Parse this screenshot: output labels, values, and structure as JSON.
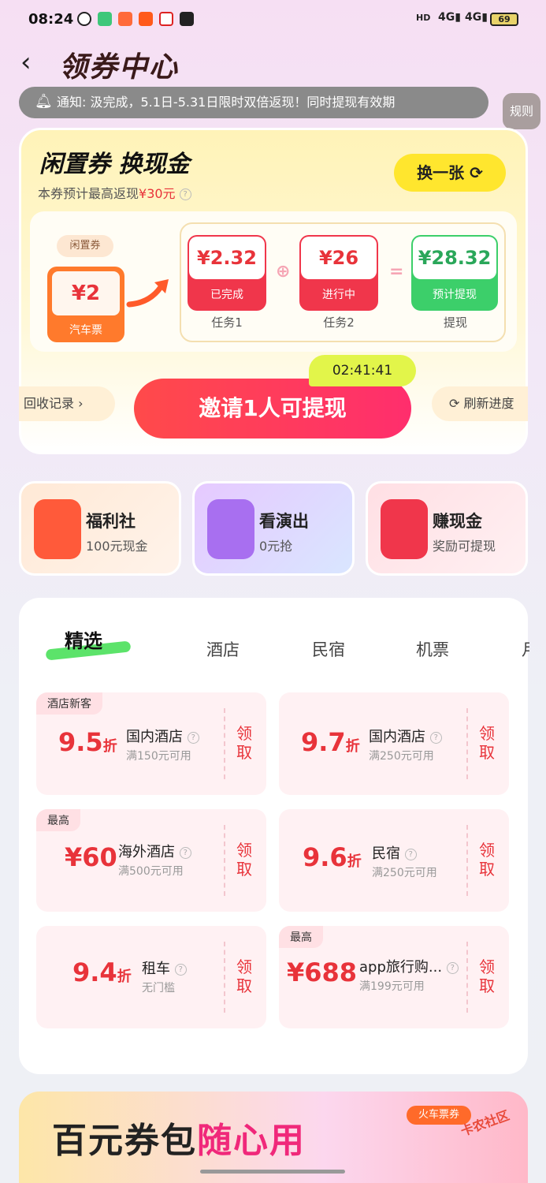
{
  "status": {
    "time": "08:24",
    "battery": "69"
  },
  "header": {
    "title": "领券中心",
    "back_label": "<",
    "rules_label": "规则"
  },
  "notice": {
    "text": "通知: 汲完成，5.1日-5.31日限时双倍返现！同时提现有效期"
  },
  "main_card": {
    "title": "闲置券 换现金",
    "subtitle_prefix": "本券预计最高返现",
    "subtitle_amount": "¥30元",
    "swap_label": "换一张",
    "ticket_tag": "闲置券",
    "ticket_value": "¥2",
    "ticket_label": "汽车票",
    "tasks": [
      {
        "value": "¥2.32",
        "status": "已完成",
        "label": "任务1"
      },
      {
        "value": "¥26",
        "status": "进行中",
        "label": "任务2"
      },
      {
        "value": "¥28.32",
        "status": "预计提现",
        "label": "提现"
      }
    ],
    "invite_label": "邀请1人可提现",
    "countdown": "02:41:41",
    "records_label": "回收记录",
    "refresh_label": "刷新进度"
  },
  "features": [
    {
      "title": "福利社",
      "sub": "100元现金"
    },
    {
      "title": "看演出",
      "sub": "0元抢"
    },
    {
      "title": "赚现金",
      "sub": "奖励可提现"
    }
  ],
  "tabs": [
    "精选",
    "酒店",
    "民宿",
    "机票",
    "月"
  ],
  "coupons": [
    {
      "badge": "酒店新客",
      "value": "9.5",
      "unit": "折",
      "name": "国内酒店",
      "cond": "满150元可用",
      "action": "领取"
    },
    {
      "badge": "",
      "value": "9.7",
      "unit": "折",
      "name": "国内酒店",
      "cond": "满250元可用",
      "action": "领取"
    },
    {
      "badge": "最高",
      "value": "¥60",
      "unit": "",
      "name": "海外酒店",
      "cond": "满500元可用",
      "action": "领取"
    },
    {
      "badge": "",
      "value": "9.6",
      "unit": "折",
      "name": "民宿",
      "cond": "满250元可用",
      "action": "领取"
    },
    {
      "badge": "",
      "value": "9.4",
      "unit": "折",
      "name": "租车",
      "cond": "无门槛",
      "action": "领取"
    },
    {
      "badge": "最高",
      "value": "¥688",
      "unit": "",
      "name": "app旅行购...",
      "cond": "满199元可用",
      "action": "领取"
    }
  ],
  "banner": {
    "text_a": "百元券包",
    "text_b": "随心用",
    "tag": "火车票券",
    "watermark": "卡农社区"
  },
  "colors": {
    "accent_red": "#e8333a",
    "pink": "#f0287a",
    "yellow": "#ffe62e",
    "green": "#5ce36a"
  }
}
